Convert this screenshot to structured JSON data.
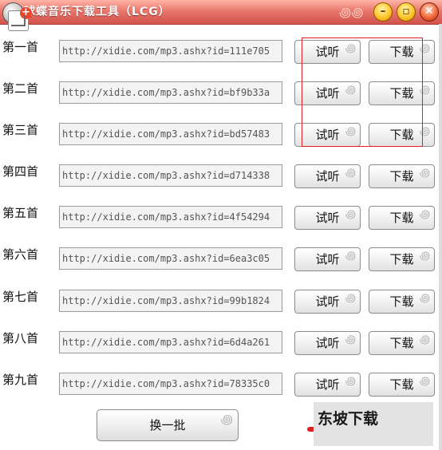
{
  "window": {
    "title": "球蝶音乐下载工具（LCG）",
    "minimize_glyph": "–",
    "restore_glyph": "▫",
    "close_glyph": "✕"
  },
  "toolbar": {
    "add_glyph": "+"
  },
  "songs": [
    {
      "label": "第一首",
      "url": "http://xidie.com/mp3.ashx?id=111e705",
      "listen": "试听",
      "download": "下载"
    },
    {
      "label": "第二首",
      "url": "http://xidie.com/mp3.ashx?id=bf9b33a",
      "listen": "试听",
      "download": "下载"
    },
    {
      "label": "第三首",
      "url": "http://xidie.com/mp3.ashx?id=bd57483",
      "listen": "试听",
      "download": "下载"
    },
    {
      "label": "第四首",
      "url": "http://xidie.com/mp3.ashx?id=d714338",
      "listen": "试听",
      "download": "下载"
    },
    {
      "label": "第五首",
      "url": "http://xidie.com/mp3.ashx?id=4f54294",
      "listen": "试听",
      "download": "下载"
    },
    {
      "label": "第六首",
      "url": "http://xidie.com/mp3.ashx?id=6ea3c05",
      "listen": "试听",
      "download": "下载"
    },
    {
      "label": "第七首",
      "url": "http://xidie.com/mp3.ashx?id=99b1824",
      "listen": "试听",
      "download": "下载"
    },
    {
      "label": "第八首",
      "url": "http://xidie.com/mp3.ashx?id=6d4a261",
      "listen": "试听",
      "download": "下载"
    },
    {
      "label": "第九首",
      "url": "http://xidie.com/mp3.ashx?id=78335c0",
      "listen": "试听",
      "download": "下载"
    }
  ],
  "batch_button": "换一批",
  "watermark": "东坡下载",
  "colors": {
    "titlebar": "#e7756a",
    "highlight": "#e02020"
  }
}
